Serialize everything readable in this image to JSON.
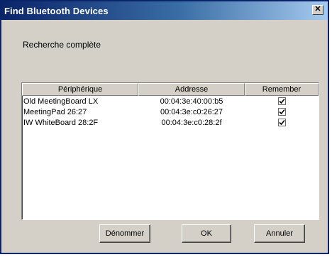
{
  "window": {
    "title": "Find Bluetooth Devices",
    "close_glyph": "✕"
  },
  "status": {
    "text": "Recherche complète"
  },
  "table": {
    "headers": [
      "Périphérique",
      "Addresse",
      "Remember"
    ],
    "rows": [
      {
        "device": "Old MeetingBoard LX",
        "address": "00:04:3e:40:00:b5",
        "remember": true
      },
      {
        "device": "MeetingPad 26:27",
        "address": "00:04:3e:c0:26:27",
        "remember": true
      },
      {
        "device": "IW WhiteBoard 28:2F",
        "address": "00:04:3e:c0:28:2f",
        "remember": true
      }
    ]
  },
  "buttons": {
    "rename": "Dénommer",
    "ok": "OK",
    "cancel": "Annuler"
  },
  "icons": {
    "close": "close-icon",
    "check": "check-icon"
  }
}
